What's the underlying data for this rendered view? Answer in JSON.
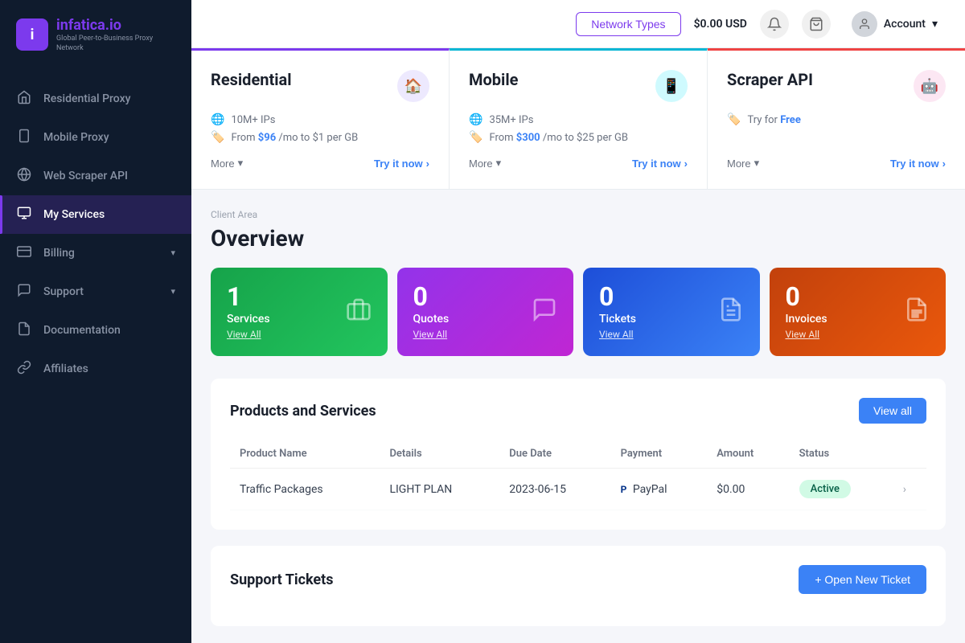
{
  "brand": {
    "name_part1": "infatica",
    "name_part2": ".io",
    "tagline": "Global Peer-to-Business Proxy Network",
    "logo_letter": "i"
  },
  "header": {
    "network_types_label": "Network Types",
    "balance": "$0.00 USD",
    "account_label": "Account",
    "chevron": "▾"
  },
  "sidebar": {
    "items": [
      {
        "label": "Residential Proxy",
        "icon": "🏠"
      },
      {
        "label": "Mobile Proxy",
        "icon": "📱"
      },
      {
        "label": "Web Scraper API",
        "icon": "🕸️"
      },
      {
        "label": "My Services",
        "icon": "🗂️",
        "active": true
      },
      {
        "label": "Billing",
        "icon": "💳",
        "has_arrow": true
      },
      {
        "label": "Support",
        "icon": "💬",
        "has_arrow": true
      },
      {
        "label": "Documentation",
        "icon": "📄"
      },
      {
        "label": "Affiliates",
        "icon": "🔗"
      }
    ]
  },
  "product_cards": [
    {
      "id": "residential",
      "title": "Residential",
      "icon": "🏠",
      "icon_class": "purple",
      "border_class": "residential",
      "features": [
        {
          "icon": "🌐",
          "text": "10M+ IPs"
        },
        {
          "icon": "🏷️",
          "text_prefix": "From ",
          "price": "$96",
          "text_suffix": " /mo to $1 per GB"
        }
      ],
      "more_label": "More",
      "try_label": "Try it now"
    },
    {
      "id": "mobile",
      "title": "Mobile",
      "icon": "📱",
      "icon_class": "cyan",
      "border_class": "mobile",
      "features": [
        {
          "icon": "🌐",
          "text": "35M+ IPs"
        },
        {
          "icon": "🏷️",
          "text_prefix": "From ",
          "price": "$300",
          "text_suffix": " /mo to $25 per GB"
        }
      ],
      "more_label": "More",
      "try_label": "Try it now"
    },
    {
      "id": "scraper",
      "title": "Scraper API",
      "icon": "🤖",
      "icon_class": "pink",
      "border_class": "scraper",
      "features": [
        {
          "icon": "🏷️",
          "text_prefix": "Try for ",
          "price": "Free",
          "text_suffix": ""
        }
      ],
      "more_label": "More",
      "try_label": "Try it now"
    }
  ],
  "overview": {
    "breadcrumb": "Client Area",
    "title": "Overview",
    "stats": [
      {
        "number": "1",
        "label": "Services",
        "view_all": "View All",
        "color": "green",
        "icon": "💼"
      },
      {
        "number": "0",
        "label": "Quotes",
        "view_all": "View All",
        "color": "purple",
        "icon": "💬"
      },
      {
        "number": "0",
        "label": "Tickets",
        "view_all": "View All",
        "color": "blue",
        "icon": "🎫"
      },
      {
        "number": "0",
        "label": "Invoices",
        "view_all": "View All",
        "color": "orange",
        "icon": "📄"
      }
    ]
  },
  "products_table": {
    "title": "Products and Services",
    "view_all_label": "View all",
    "columns": [
      "Product Name",
      "Details",
      "Due Date",
      "Payment",
      "Amount",
      "Status"
    ],
    "rows": [
      {
        "product_name": "Traffic Packages",
        "details": "LIGHT PLAN",
        "due_date": "2023-06-15",
        "payment": "PayPal",
        "amount": "$0.00",
        "status": "Active"
      }
    ]
  },
  "support_tickets": {
    "title": "Support Tickets",
    "open_ticket_label": "+ Open New Ticket"
  }
}
